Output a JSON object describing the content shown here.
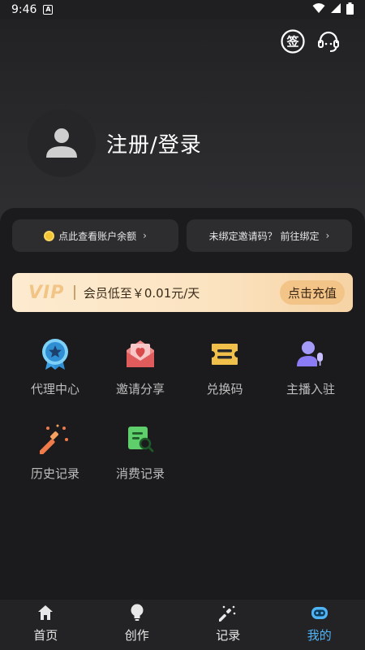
{
  "status_bar": {
    "time": "9:46",
    "badge": "A"
  },
  "header": {
    "sign_icon_label": "签",
    "login_text": "注册/登录"
  },
  "account": {
    "balance_text": "点此查看账户余额",
    "invite_text": "未绑定邀请码？ 前往绑定"
  },
  "vip": {
    "label": "VIP",
    "text": "会员低至￥0.01元/天",
    "button": "点击充值"
  },
  "menu": {
    "items": [
      {
        "label": "代理中心",
        "icon": "badge-star-icon",
        "color": "#3aa0e6"
      },
      {
        "label": "邀请分享",
        "icon": "envelope-heart-icon",
        "color": "#e46b6b"
      },
      {
        "label": "兑换码",
        "icon": "ticket-icon",
        "color": "#f0c04a"
      },
      {
        "label": "主播入驻",
        "icon": "anchor-mic-icon",
        "color": "#8b7cf6"
      },
      {
        "label": "历史记录",
        "icon": "magic-wand-icon",
        "color": "#f07a4a"
      },
      {
        "label": "消费记录",
        "icon": "receipt-search-icon",
        "color": "#5ecf6a"
      }
    ]
  },
  "tabbar": {
    "tabs": [
      {
        "label": "首页",
        "icon": "home-icon"
      },
      {
        "label": "创作",
        "icon": "bulb-icon"
      },
      {
        "label": "记录",
        "icon": "wand-icon"
      },
      {
        "label": "我的",
        "icon": "robot-icon",
        "active": true
      }
    ],
    "active_color": "#4fb4f5"
  }
}
